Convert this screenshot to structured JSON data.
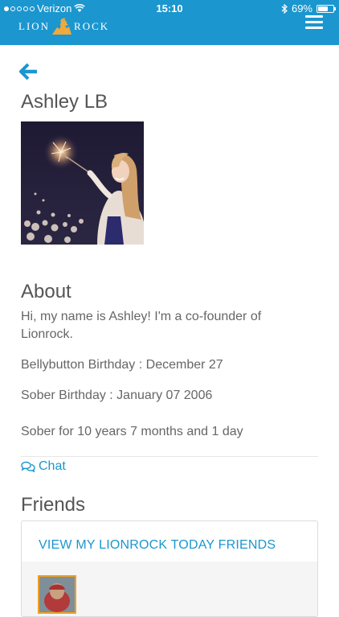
{
  "status_bar": {
    "carrier": "Verizon",
    "time": "15:10",
    "battery": "69%",
    "battery_level": 0.69
  },
  "header": {
    "logo_left": "LION",
    "logo_right": "ROCK",
    "brand_color": "#1b96cf"
  },
  "profile": {
    "name": "Ashley LB"
  },
  "about": {
    "title": "About",
    "bio": "Hi, my name is Ashley! I'm a co-founder of Lionrock.",
    "bellybutton_birthday": "Bellybutton Birthday : December 27",
    "sober_birthday": "Sober Birthday : January 07 2006",
    "sober_duration": "Sober for 10 years 7 months and 1 day"
  },
  "actions": {
    "chat_label": "Chat"
  },
  "friends": {
    "title": "Friends",
    "view_link": "VIEW MY LIONROCK TODAY FRIENDS"
  },
  "icons": {
    "back": "arrow-left-icon",
    "menu": "hamburger-menu-icon",
    "chat": "chat-bubbles-icon",
    "wifi": "wifi-icon",
    "bluetooth": "bluetooth-icon"
  }
}
